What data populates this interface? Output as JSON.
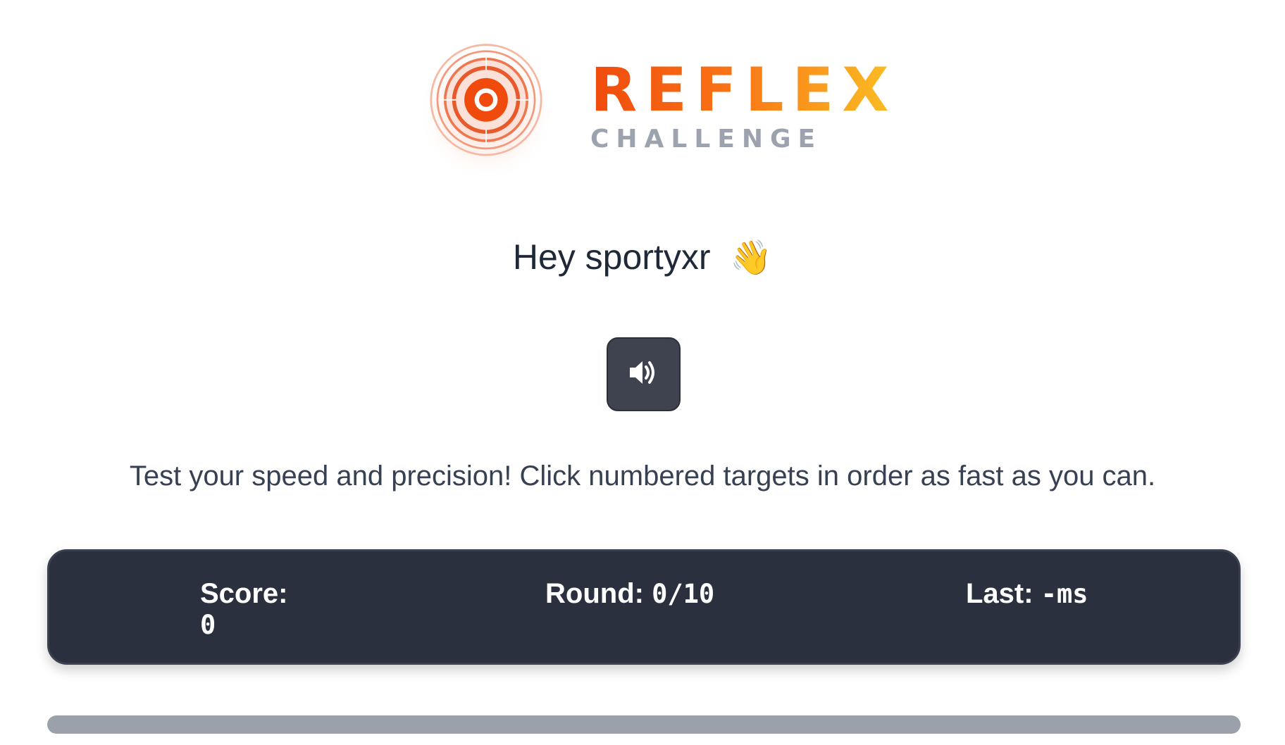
{
  "brand": {
    "title": "REFLEX",
    "subtitle": "CHALLENGE",
    "accent_start": "#f04a0c",
    "accent_end": "#fbbf24",
    "logo_icon": "target-icon"
  },
  "greeting": {
    "text": "Hey sportyxr",
    "emoji": "👋"
  },
  "sound_button": {
    "icon": "speaker-icon"
  },
  "tagline": "Test your speed and precision! Click numbered targets in order as fast as you can.",
  "stats": {
    "score_label": "Score:",
    "score_value": "0",
    "round_label": "Round:",
    "round_value": "0/10",
    "last_label": "Last:",
    "last_value": "-ms"
  },
  "progress": {
    "fraction": 1.0
  }
}
